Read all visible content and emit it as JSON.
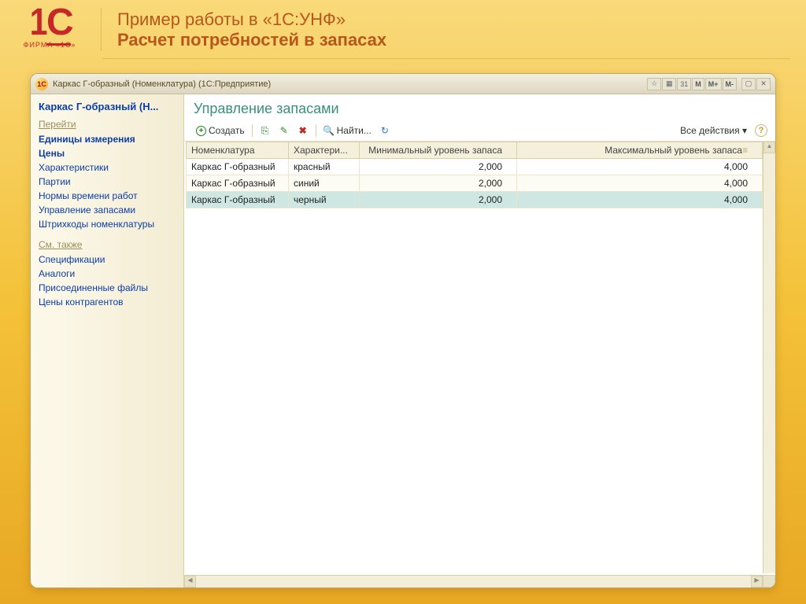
{
  "slide": {
    "logo_text": "1С",
    "logo_sub": "ФИРМА «1С»",
    "title": "Пример работы в «1С:УНФ»",
    "subtitle": "Расчет потребностей в запасах"
  },
  "window": {
    "app_icon_text": "1С",
    "title": "Каркас Г-образный (Номенклатура)  (1С:Предприятие)",
    "btn_fav": "☆",
    "btn_calc": "▦",
    "btn_cal": "31",
    "btn_m": "M",
    "btn_mplus": "M+",
    "btn_mminus": "M-",
    "btn_min": "▢",
    "btn_close": "✕"
  },
  "sidebar": {
    "title": "Каркас Г-образный (Н...",
    "section_goto": "Перейти",
    "items_goto": [
      {
        "label": "Единицы измерения",
        "bold": true
      },
      {
        "label": "Цены",
        "bold": true
      },
      {
        "label": "Характеристики",
        "bold": false
      },
      {
        "label": "Партии",
        "bold": false
      },
      {
        "label": "Нормы времени работ",
        "bold": false
      },
      {
        "label": "Управление запасами",
        "bold": false
      },
      {
        "label": "Штрихкоды номенклатуры",
        "bold": false
      }
    ],
    "section_see": "См. также",
    "items_see": [
      {
        "label": "Спецификации"
      },
      {
        "label": "Аналоги"
      },
      {
        "label": "Присоединенные файлы"
      },
      {
        "label": "Цены контрагентов"
      }
    ]
  },
  "content": {
    "title": "Управление запасами",
    "toolbar": {
      "create": "Создать",
      "find": "Найти...",
      "all_actions": "Все действия ▾",
      "help": "?"
    },
    "columns": [
      "Номенклатура",
      "Характери...",
      "Минимальный уровень запаса",
      "Максимальный уровень запаса"
    ],
    "rows": [
      {
        "nom": "Каркас Г-образный",
        "char": "красный",
        "min": "2,000",
        "max": "4,000",
        "selected": false
      },
      {
        "nom": "Каркас Г-образный",
        "char": "синий",
        "min": "2,000",
        "max": "4,000",
        "selected": false
      },
      {
        "nom": "Каркас Г-образный",
        "char": "черный",
        "min": "2,000",
        "max": "4,000",
        "selected": true
      }
    ]
  }
}
